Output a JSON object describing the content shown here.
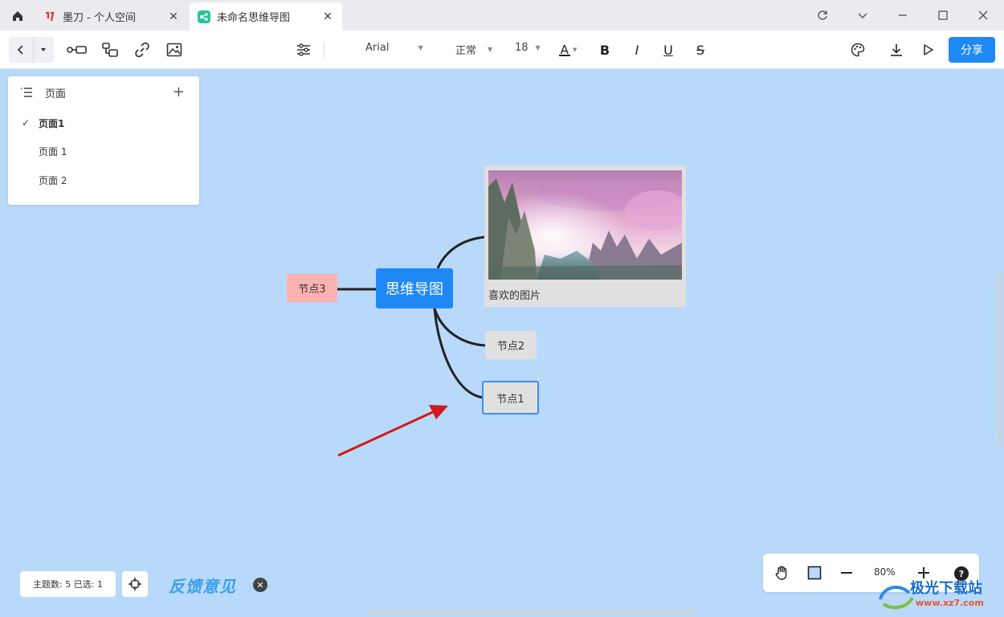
{
  "tabs": [
    {
      "title": "墨刀 - 个人空间"
    },
    {
      "title": "未命名思维导图"
    }
  ],
  "toolbar": {
    "font_family": "Arial",
    "font_weight": "正常",
    "font_size": "18",
    "font_color_letter": "A",
    "bold": "B",
    "italic": "I",
    "underline": "U",
    "strike": "S",
    "share_label": "分享"
  },
  "pages_panel": {
    "title": "页面",
    "items": [
      {
        "label": "页面1",
        "active": true
      },
      {
        "label": "页面 1",
        "active": false
      },
      {
        "label": "页面 2",
        "active": false
      }
    ]
  },
  "mindmap": {
    "root": "思维导图",
    "image_caption": "喜欢的图片",
    "node3": "节点3",
    "node2": "节点2",
    "node1": "节点1",
    "selected": "节点1"
  },
  "status": {
    "text": "主题数: 5 已选: 1"
  },
  "feedback_label": "反馈意见",
  "zoom": {
    "value": "80%"
  },
  "watermark": {
    "name": "极光下载站",
    "url": "www.xz7.com"
  },
  "colors": {
    "canvas_bg": "#b9d9fb",
    "root_node": "#1e88f5",
    "node3_bg": "#fcb3b1",
    "node_bg": "#e0e0e0",
    "accent": "#1e88f5",
    "annotation_arrow": "#d11a1a"
  }
}
